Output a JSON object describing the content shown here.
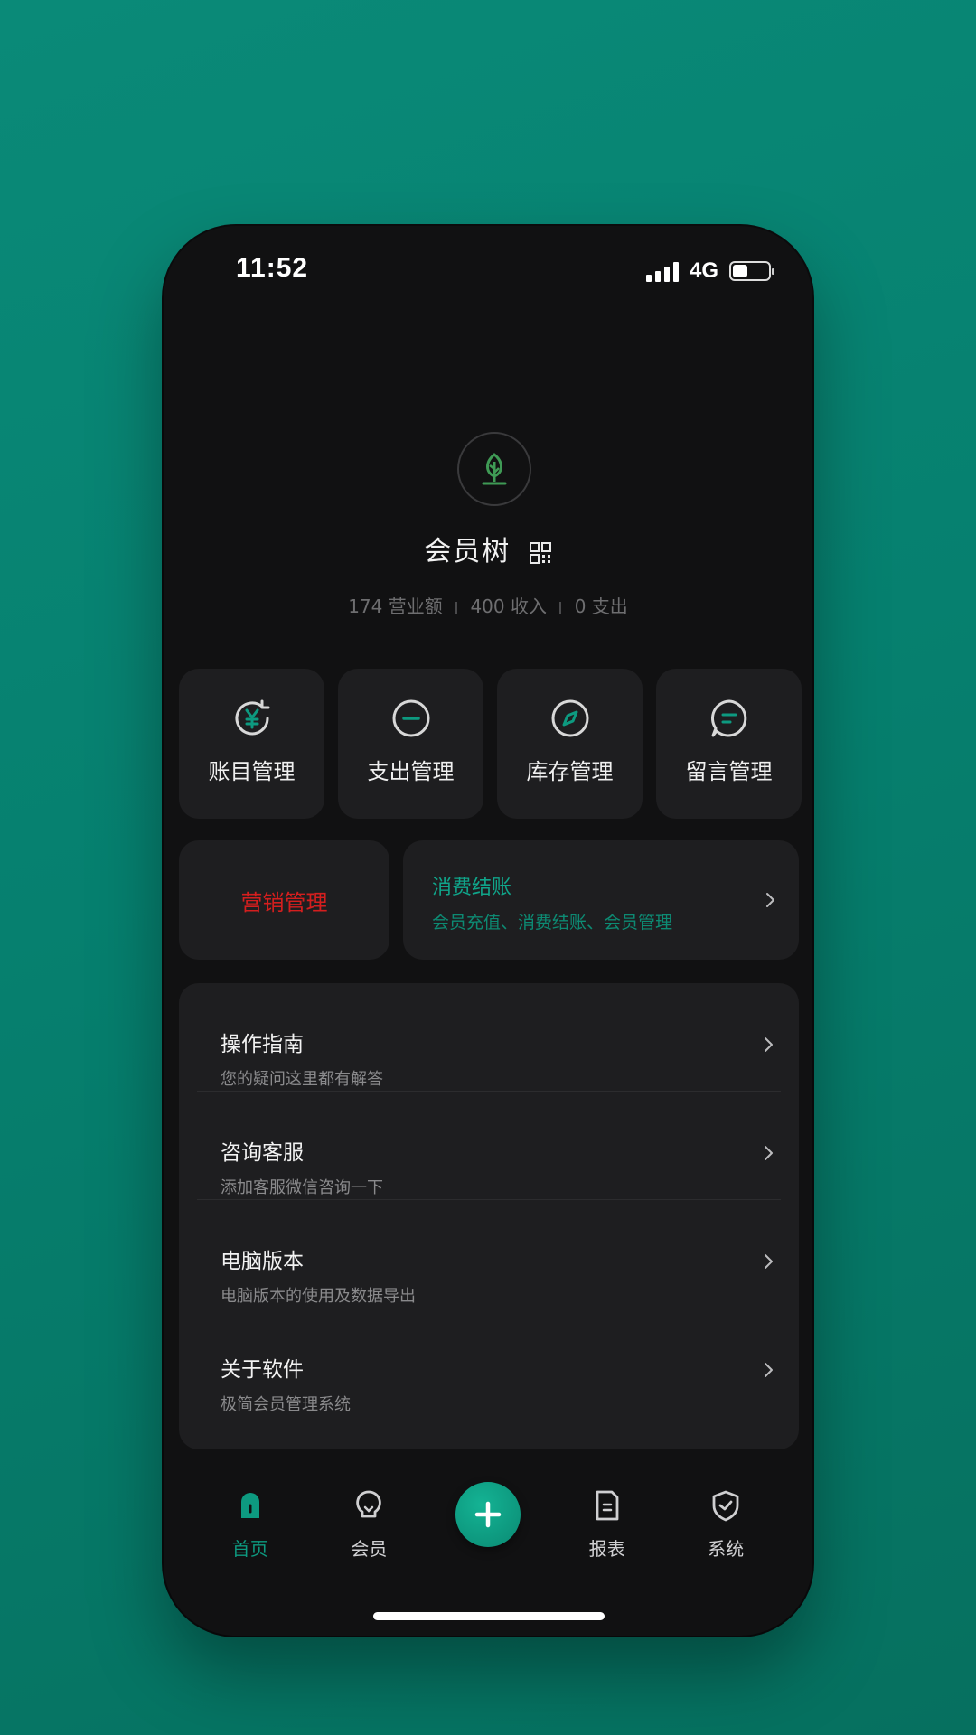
{
  "status": {
    "time": "11:52",
    "network": "4G"
  },
  "app": {
    "title": "会员树",
    "stats": [
      {
        "value": "174",
        "label": "营业额"
      },
      {
        "value": "400",
        "label": "收入"
      },
      {
        "value": "0",
        "label": "支出"
      }
    ]
  },
  "tiles": [
    {
      "label": "账目管理",
      "icon": "yuan-refresh-icon"
    },
    {
      "label": "支出管理",
      "icon": "minus-circle-icon"
    },
    {
      "label": "库存管理",
      "icon": "compass-icon"
    },
    {
      "label": "留言管理",
      "icon": "chat-bubble-icon"
    }
  ],
  "marketing": {
    "label": "营销管理"
  },
  "checkout": {
    "title": "消费结账",
    "subtitle": "会员充值、消费结账、会员管理"
  },
  "list": [
    {
      "title": "操作指南",
      "subtitle": "您的疑问这里都有解答"
    },
    {
      "title": "咨询客服",
      "subtitle": "添加客服微信咨询一下"
    },
    {
      "title": "电脑版本",
      "subtitle": "电脑版本的使用及数据导出"
    },
    {
      "title": "关于软件",
      "subtitle": "极简会员管理系统"
    }
  ],
  "tabs": [
    {
      "label": "首页",
      "icon": "home-icon",
      "active": true
    },
    {
      "label": "会员",
      "icon": "bulb-icon",
      "active": false
    },
    {
      "label": "报表",
      "icon": "document-icon",
      "active": false
    },
    {
      "label": "系统",
      "icon": "shield-check-icon",
      "active": false
    }
  ],
  "colors": {
    "accent": "#0d9a80",
    "marketing": "#d41e1e",
    "background": "#111112",
    "card": "#1e1e20"
  }
}
